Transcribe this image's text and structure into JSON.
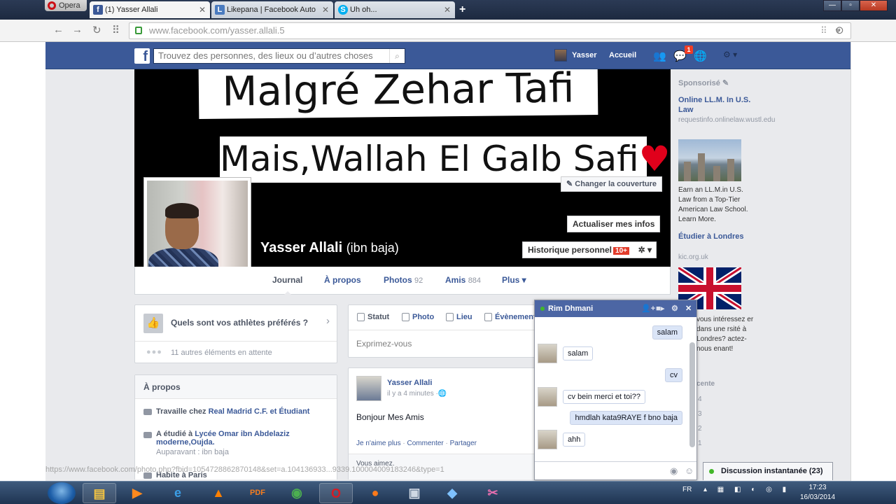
{
  "browser": {
    "menu_label": "Opera",
    "tabs": [
      {
        "label": "(1) Yasser Allali",
        "icon": "facebook-icon"
      },
      {
        "label": "Likepana | Facebook Auto",
        "icon": "likepana-icon"
      },
      {
        "label": "Uh oh...",
        "icon": "skype-icon"
      }
    ],
    "url_host": "www.facebook.com/",
    "url_path": "yasser.allali.5"
  },
  "fb": {
    "search_placeholder": "Trouvez des personnes, des lieux ou d’autres choses",
    "user_name": "Yasser",
    "home_label": "Accueil",
    "notif_count": "1"
  },
  "cover": {
    "banner_line1": "Malgré Zehar Tafi",
    "banner_line2": "Mais,Wallah El Galb Safi",
    "heart": "♥",
    "change_cover": "Changer la couverture",
    "update_info": "Actualiser mes infos",
    "activity_log": "Historique personnel",
    "activity_count": "10+",
    "name": "Yasser Allali",
    "alt_name": "(ibn baja)"
  },
  "profile_tabs": [
    {
      "label": "Journal",
      "count": ""
    },
    {
      "label": "À propos",
      "count": ""
    },
    {
      "label": "Photos",
      "count": "92"
    },
    {
      "label": "Amis",
      "count": "884"
    },
    {
      "label": "Plus ▾",
      "count": ""
    }
  ],
  "athletes": {
    "question": "Quels sont vos athlètes préférés ?",
    "pending": "11 autres éléments en attente"
  },
  "about": {
    "title": "À propos",
    "work_prefix": "Travaille chez ",
    "work_link": "Real Madrid C.F. et Étudiant",
    "study_prefix": "A étudié à ",
    "study_link": "Lycée Omar ibn Abdelaziz moderne,Oujda.",
    "study_sub": "Auparavant : ibn baja",
    "lives_label": "Habite à Paris"
  },
  "composer": {
    "tabs": [
      "Statut",
      "Photo",
      "Lieu",
      "Évènement"
    ],
    "placeholder": "Exprimez-vous"
  },
  "post": {
    "author": "Yasser Allali",
    "time": "il y a 4 minutes",
    "text": "Bonjour Mes Amis",
    "actions": [
      "Je n'aime plus",
      "Commenter",
      "Partager"
    ],
    "likes": "Vous aimez."
  },
  "ads": {
    "sponsored": "Sponsorisé",
    "ad1_title": "Online LL.M. In U.S. Law",
    "ad1_url": "requestinfo.onlinelaw.wustl.edu",
    "ad1_body": "Earn an LL.M.in U.S. Law from a Top-Tier American Law School. Learn More.",
    "ad2_title": "Étudier à Londres",
    "ad2_url": "kic.org.uk",
    "ad2_body": "vous intéressez er dans une rsité à Londres? actez-nous enant!",
    "side_title": "cente",
    "side_nums": [
      "4",
      "3",
      "2",
      "1"
    ]
  },
  "chat": {
    "name": "Rim Dhmani",
    "messages": [
      {
        "from": "me",
        "text": "salam"
      },
      {
        "from": "them",
        "text": "salam"
      },
      {
        "from": "me",
        "text": "cv"
      },
      {
        "from": "them",
        "text": "cv bein merci et toi??"
      },
      {
        "from": "me",
        "text": "hmdlah kata9RAYE f bno baja"
      },
      {
        "from": "them",
        "text": "ahh"
      }
    ]
  },
  "chat_bar": {
    "label": "Discussion instantanée (23)"
  },
  "status_url": "https://www.facebook.com/photo.php?fbid=1054728862870148&set=a.104136933...9339.100004009183246&type=1",
  "taskbar": {
    "lang": "FR",
    "time": "17:23",
    "date": "16/03/2014"
  },
  "colors": {
    "fb_blue": "#3b5998",
    "chat_header": "#4c66a4",
    "badge_red": "#f03d25",
    "heart_red": "#e0001b"
  }
}
